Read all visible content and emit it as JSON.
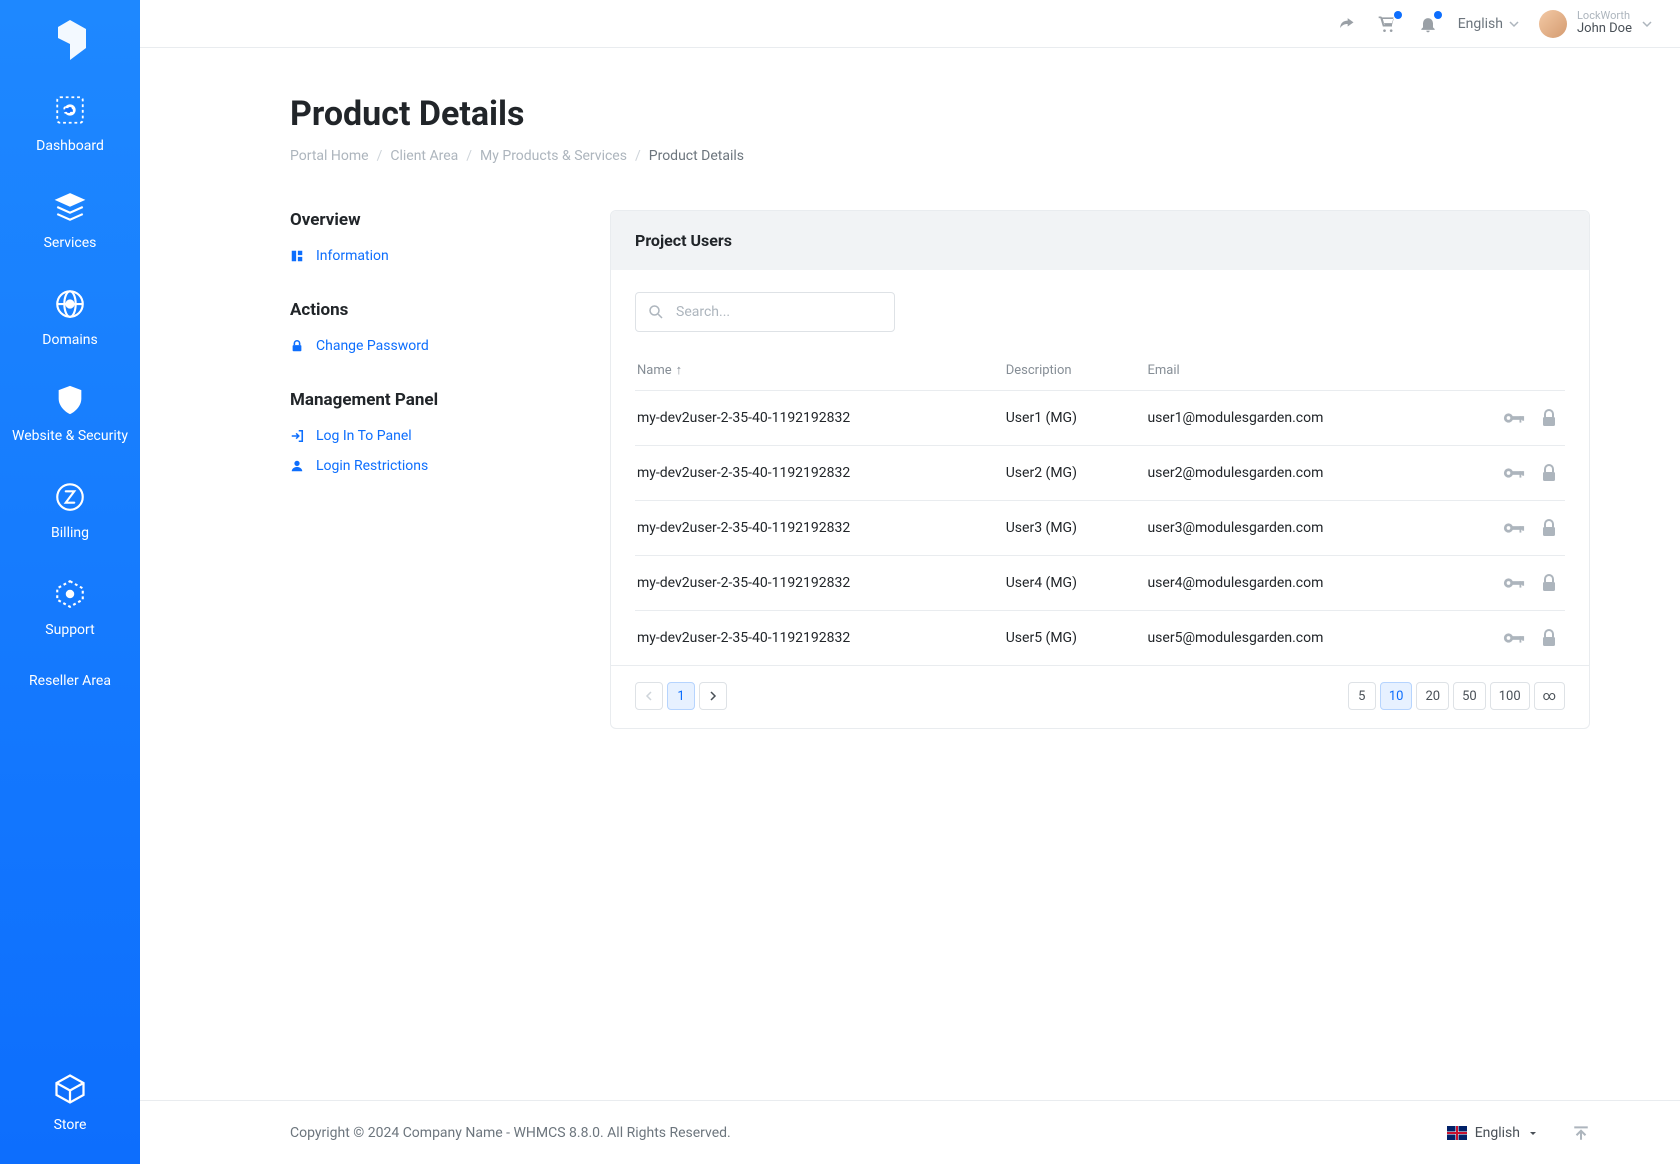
{
  "sidebar": {
    "items": [
      {
        "label": "Dashboard"
      },
      {
        "label": "Services"
      },
      {
        "label": "Domains"
      },
      {
        "label": "Website & Security"
      },
      {
        "label": "Billing"
      },
      {
        "label": "Support"
      },
      {
        "label": "Reseller Area"
      }
    ],
    "bottom": {
      "label": "Store"
    }
  },
  "topbar": {
    "language": "English",
    "company": "LockWorth",
    "username": "John Doe"
  },
  "page": {
    "title": "Product Details",
    "breadcrumb": [
      "Portal Home",
      "Client Area",
      "My Products & Services",
      "Product Details"
    ]
  },
  "nav": {
    "overview_title": "Overview",
    "overview_items": [
      {
        "label": "Information"
      }
    ],
    "actions_title": "Actions",
    "actions_items": [
      {
        "label": "Change Password"
      }
    ],
    "mgmt_title": "Management Panel",
    "mgmt_items": [
      {
        "label": "Log In To Panel"
      },
      {
        "label": "Login Restrictions"
      }
    ]
  },
  "panel": {
    "title": "Project Users",
    "search_placeholder": "Search...",
    "columns": {
      "name": "Name",
      "description": "Description",
      "email": "Email"
    },
    "rows": [
      {
        "name": "my-dev2user-2-35-40-1192192832",
        "description": "User1 (MG)",
        "email": "user1@modulesgarden.com"
      },
      {
        "name": "my-dev2user-2-35-40-1192192832",
        "description": "User2 (MG)",
        "email": "user2@modulesgarden.com"
      },
      {
        "name": "my-dev2user-2-35-40-1192192832",
        "description": "User3 (MG)",
        "email": "user3@modulesgarden.com"
      },
      {
        "name": "my-dev2user-2-35-40-1192192832",
        "description": "User4 (MG)",
        "email": "user4@modulesgarden.com"
      },
      {
        "name": "my-dev2user-2-35-40-1192192832",
        "description": "User5 (MG)",
        "email": "user5@modulesgarden.com"
      }
    ],
    "pagination": {
      "current": "1",
      "sizes": [
        "5",
        "10",
        "20",
        "50",
        "100",
        "∞"
      ],
      "active_size": "10"
    }
  },
  "footer": {
    "copyright": "Copyright © 2024 Company Name - WHMCS 8.8.0. All Rights Reserved.",
    "language": "English"
  }
}
